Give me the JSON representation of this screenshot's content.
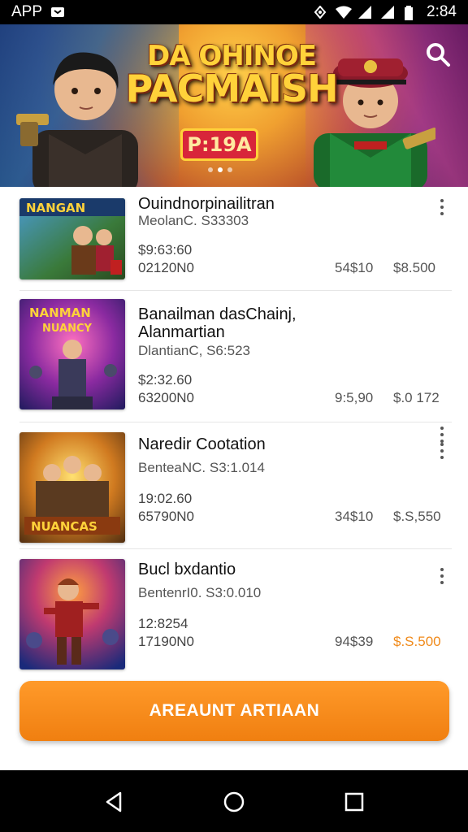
{
  "status_bar": {
    "app_label": "APP",
    "time": "2:84"
  },
  "banner": {
    "title_line1": "DA OHINOE",
    "title_line2": "PACMAISH",
    "tag": "P:19A"
  },
  "items": [
    {
      "title": "Ouindnorpinailitran",
      "developer": "MeolanC. S33303",
      "line3": "$9:63:60",
      "line4": "02120N0",
      "val1": "54$10",
      "val2": "$8.500",
      "val2_orange": false
    },
    {
      "title": "Banailman dasChainj,\nAlanmartian",
      "developer": "DlantianC, S6:523",
      "line3": "$2:32.60",
      "line4": "63200N0",
      "val1": "9:5,90",
      "val2": "$.0 172",
      "val2_orange": false
    },
    {
      "title": "Naredir Cootation",
      "developer": "BenteaNC. S3:1.014",
      "line3": "19:02.60",
      "line4": "65790N0",
      "val1": "34$10",
      "val2": "$.S,550",
      "val2_orange": false
    },
    {
      "title": "Bucl bxdantio",
      "developer": "BentenrI0. S3:0.010",
      "line3": "12:8254",
      "line4": "17190N0",
      "val1": "94$39",
      "val2": "$.S.500",
      "val2_orange": true
    }
  ],
  "thumb_labels": [
    "NANGAN",
    "NANMAN\nNUANCY",
    "",
    "NUANCAS"
  ],
  "cta": {
    "label": "AREAUNT ARTIAAN"
  },
  "colors": {
    "accent": "#f08a1a",
    "nav_bg": "#000000"
  }
}
